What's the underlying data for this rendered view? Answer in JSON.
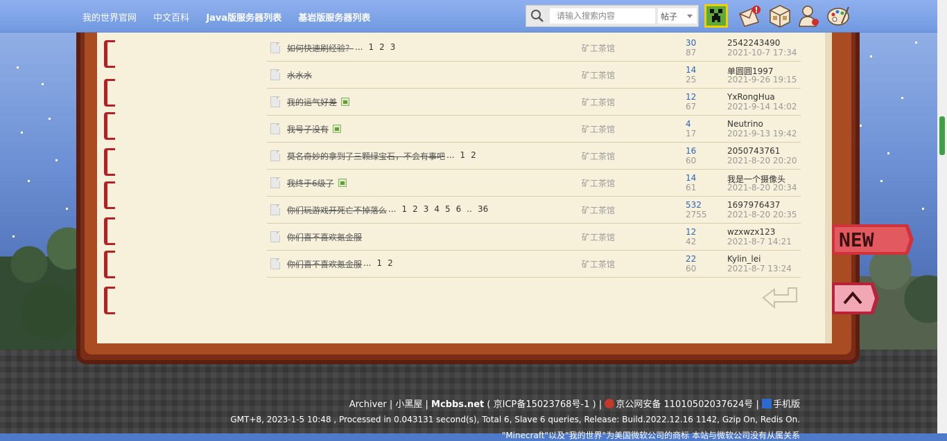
{
  "nav": {
    "items": [
      {
        "label": "我的世界官网",
        "bold": false
      },
      {
        "label": "中文百科",
        "bold": false
      },
      {
        "label": "Java版服务器列表",
        "bold": true
      },
      {
        "label": "基岩版服务器列表",
        "bold": true
      }
    ]
  },
  "search": {
    "placeholder": "请输入搜索内容",
    "type_selected": "帖子"
  },
  "threads": [
    {
      "title": "如何快速刷经验？",
      "ellipsis": "...",
      "pages": [
        "1",
        "2",
        "3"
      ],
      "has_image": false,
      "forum": "矿工茶馆",
      "replies": "30",
      "views": "87",
      "author": "2542243490",
      "date": "2021-10-7 17:34"
    },
    {
      "title": "水水水",
      "ellipsis": "",
      "pages": [],
      "has_image": false,
      "forum": "矿工茶馆",
      "replies": "14",
      "views": "25",
      "author": "单圆圆1997",
      "date": "2021-9-26 19:15"
    },
    {
      "title": "我的运气好差",
      "ellipsis": "",
      "pages": [],
      "has_image": true,
      "forum": "矿工茶馆",
      "replies": "12",
      "views": "67",
      "author": "YxRongHua",
      "date": "2021-9-14 14:02"
    },
    {
      "title": "我号子没有",
      "ellipsis": "",
      "pages": [],
      "has_image": true,
      "forum": "矿工茶馆",
      "replies": "4",
      "views": "17",
      "author": "Neutrino",
      "date": "2021-9-13 19:42"
    },
    {
      "title": "莫名奇妙的拿到了三颗绿宝石，不会有事吧",
      "ellipsis": "...",
      "pages": [
        "1",
        "2"
      ],
      "has_image": false,
      "forum": "矿工茶馆",
      "replies": "16",
      "views": "60",
      "author": "2050743761",
      "date": "2021-8-20 20:20"
    },
    {
      "title": "我终于6级了",
      "ellipsis": "",
      "pages": [],
      "has_image": true,
      "forum": "矿工茶馆",
      "replies": "14",
      "views": "61",
      "author": "我是一个摄像头",
      "date": "2021-8-20 20:34"
    },
    {
      "title": "你们玩游戏开死亡不掉落么",
      "ellipsis": "...",
      "pages": [
        "1",
        "2",
        "3",
        "4",
        "5",
        "6",
        "..",
        "36"
      ],
      "has_image": false,
      "forum": "矿工茶馆",
      "replies": "532",
      "views": "2755",
      "author": "1697976437",
      "date": "2021-8-20 20:35"
    },
    {
      "title": "你们喜不喜欢氪金服",
      "ellipsis": "",
      "pages": [],
      "has_image": false,
      "forum": "矿工茶馆",
      "replies": "12",
      "views": "42",
      "author": "wzxwzx123",
      "date": "2021-8-7 14:21"
    },
    {
      "title": "你们喜不喜欢氪金服",
      "ellipsis": "...",
      "pages": [
        "1",
        "2"
      ],
      "has_image": false,
      "forum": "矿工茶馆",
      "replies": "22",
      "views": "60",
      "author": "Kylin_lei",
      "date": "2021-8-7 13:24"
    }
  ],
  "footer": {
    "archiver": "Archiver",
    "sep1": "|",
    "xiaoheiwu": "小黑屋",
    "sep2": "|",
    "site": "Mcbbs.net",
    "icp": "( 京ICP备15023768号-1 )",
    "sep3": "|",
    "police": "京公网安备 11010502037624号",
    "sep4": "|",
    "mobile": "手机版",
    "stats": "GMT+8, 2023-1-5 10:48 , Processed in 0.043131 second(s), Total 6, Slave 6 queries, Release: Build.2022.12.16 1142, Gzip On, Redis On.",
    "disclaimer": "\"Minecraft\"以及\"我的世界\"为美国微软公司的商标 本站与微软公司没有从属关系"
  },
  "colors": {
    "nav_bg": "#7fa3e8",
    "page_bg": "#f7f0da",
    "book_cover": "#7a2c17",
    "reply_count": "#2a64b4",
    "scroll_thumb": "#3fa048"
  },
  "icons": {
    "search": "search-icon",
    "creeper": "creeper-avatar-icon",
    "mail": "mail-notification-icon",
    "box": "crafting-box-icon",
    "user": "user-profile-icon",
    "palette": "palette-icon"
  }
}
